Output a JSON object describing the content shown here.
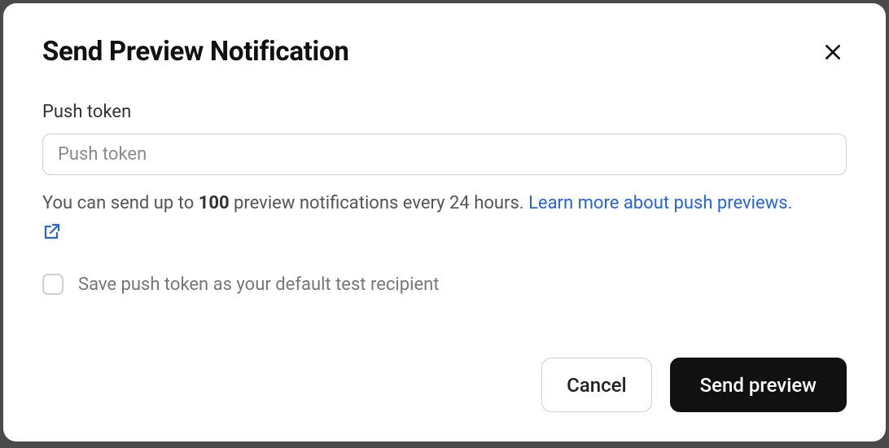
{
  "modal": {
    "title": "Send Preview Notification",
    "field": {
      "label": "Push token",
      "placeholder": "Push token",
      "value": ""
    },
    "helper": {
      "prefix": "You can send up to ",
      "limit": "100",
      "suffix": " preview notifications every 24 hours. ",
      "link_text": "Learn more about push previews."
    },
    "checkbox": {
      "label": "Save push token as your default test recipient",
      "checked": false
    },
    "actions": {
      "cancel": "Cancel",
      "submit": "Send preview"
    }
  }
}
